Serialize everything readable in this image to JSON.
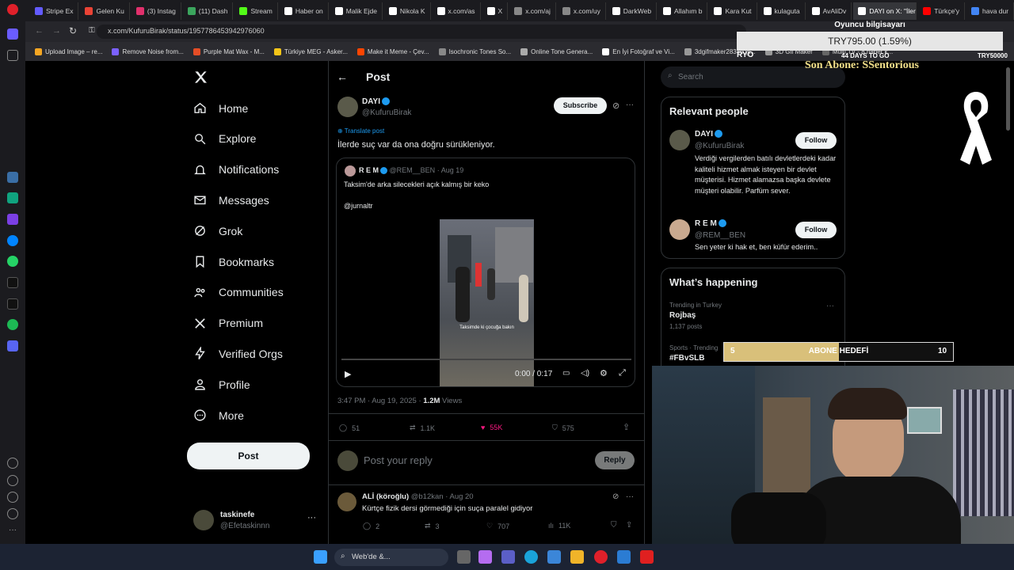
{
  "browser": {
    "tabs": [
      {
        "label": "Stripe Ex",
        "color": "#635bff"
      },
      {
        "label": "Gelen Ku",
        "color": "#ea4335"
      },
      {
        "label": "(3) Instag",
        "color": "#e1306c"
      },
      {
        "label": "(11) Dash",
        "color": "#3ba55d"
      },
      {
        "label": "Stream",
        "color": "#53fc18"
      },
      {
        "label": "Haber on",
        "color": "#ffffff"
      },
      {
        "label": "Malik Ejde",
        "color": "#ffffff"
      },
      {
        "label": "Nikola K",
        "color": "#ffffff"
      },
      {
        "label": "x.com/as",
        "color": "#ffffff"
      },
      {
        "label": "X",
        "color": "#ffffff"
      },
      {
        "label": "x.com/aj",
        "color": "#888888"
      },
      {
        "label": "x.com/uy",
        "color": "#888888"
      },
      {
        "label": "DarkWeb",
        "color": "#ffffff"
      },
      {
        "label": "Allahım b",
        "color": "#ffffff"
      },
      {
        "label": "Kara Kut",
        "color": "#ffffff"
      },
      {
        "label": "kulaguta",
        "color": "#ffffff"
      },
      {
        "label": "AvAliDv",
        "color": "#ffffff"
      },
      {
        "label": "DAYI on X: \"İlerd",
        "color": "#ffffff",
        "active": true
      },
      {
        "label": "Türkçe'y",
        "color": "#ff0000"
      },
      {
        "label": "hava dur",
        "color": "#4285f4"
      }
    ],
    "url": "x.com/KufuruBirak/status/1957786453942976060",
    "bookmarks": [
      {
        "label": "Upload Image – re...",
        "color": "#f5a623"
      },
      {
        "label": "Remove Noise from...",
        "color": "#7b61ff"
      },
      {
        "label": "Purple Mat Wax - M...",
        "color": "#e44d26"
      },
      {
        "label": "Türkiye MEG - Asker...",
        "color": "#f5c518"
      },
      {
        "label": "Make it Meme - Çev...",
        "color": "#ff4500"
      },
      {
        "label": "Isochronic Tones So...",
        "color": "#888888"
      },
      {
        "label": "Online Tone Genera...",
        "color": "#aaaaaa"
      },
      {
        "label": "En İyi Fotoğraf ve Vi...",
        "color": "#ffffff"
      },
      {
        "label": "3dgifmaker28349.gi...",
        "color": "#999999"
      },
      {
        "label": "3D Gif Maker",
        "color": "#999999"
      },
      {
        "label": "Multi TV - 8 haber k...",
        "color": "#666666"
      }
    ]
  },
  "sidebar": {
    "items": [
      {
        "label": "Home",
        "icon": "home-icon"
      },
      {
        "label": "Explore",
        "icon": "search-icon"
      },
      {
        "label": "Notifications",
        "icon": "bell-icon"
      },
      {
        "label": "Messages",
        "icon": "mail-icon"
      },
      {
        "label": "Grok",
        "icon": "grok-icon"
      },
      {
        "label": "Bookmarks",
        "icon": "bookmark-icon"
      },
      {
        "label": "Communities",
        "icon": "people-icon"
      },
      {
        "label": "Premium",
        "icon": "x-icon"
      },
      {
        "label": "Verified Orgs",
        "icon": "lightning-icon"
      },
      {
        "label": "Profile",
        "icon": "person-icon"
      },
      {
        "label": "More",
        "icon": "more-circle-icon"
      }
    ],
    "post_button": "Post",
    "account": {
      "name": "taskinefe",
      "handle": "@Efetaskinnn"
    }
  },
  "post_page": {
    "header_title": "Post",
    "author_name": "DAYI",
    "author_handle": "@KufuruBirak",
    "subscribe_label": "Subscribe",
    "translate_label": "Translate post",
    "text": "İlerde suç var da ona doğru sürükleniyor.",
    "quote": {
      "name": "R E M",
      "handle": "@REM__BEN",
      "date": "Aug 19",
      "text1": "Taksim'de arka silecekleri açık kalmış bir keko",
      "text2": "@jurnaltr",
      "video_caption": "Taksimde ki çocuğa bakın",
      "video_time": "0:00 / 0:17"
    },
    "timestamp": "3:47 PM · Aug 19, 2025 · ",
    "views": "1.2M",
    "views_label": " Views",
    "replies": "51",
    "reposts": "1.1K",
    "likes": "55K",
    "bookmarks": "575",
    "reply_placeholder": "Post your reply",
    "reply_button": "Reply",
    "reply": {
      "name": "ALİ (köroğlu)",
      "handle": "@b12kan · Aug 20",
      "text": "Kürtçe fizik dersi görmediği için suça paralel gidiyor",
      "replies": "2",
      "reposts": "3",
      "likes": "707",
      "views": "11K"
    }
  },
  "right": {
    "search_placeholder": "Search",
    "relevant_title": "Relevant people",
    "people": [
      {
        "name": "DAYI",
        "handle": "@KufuruBirak",
        "bio": "Verdiği vergilerden batılı devletlerdeki kadar kaliteli hizmet almak isteyen bir devlet müşterisi. Hizmet alamazsa başka devlete müşteri olabilir. Parfüm sever.",
        "follow": "Follow"
      },
      {
        "name": "R E M",
        "handle": "@REM__BEN",
        "bio": "Sen yeter ki hak et, ben küfür ederim..",
        "follow": "Follow"
      }
    ],
    "happening_title": "What’s happening",
    "trends": [
      {
        "context": "Trending in Turkey",
        "name": "Rojbaş",
        "count": "1,137 posts"
      },
      {
        "context": "Sports · Trending",
        "name": "#FBvSLB",
        "count": ""
      }
    ]
  },
  "overlay": {
    "pc_label": "Oyuncu bilgisayarı",
    "donation": "TRY795.00 (1.59%)",
    "ryo": "RYO",
    "days": "44 DAYS TO GO",
    "goal": "TRY50000",
    "son_abone": "Son Abone: SSentorious",
    "sub_goal_left": "5",
    "sub_goal_label": "ABONE HEDEFİ",
    "sub_goal_right": "10",
    "sub_goal_progress": 0.5
  },
  "taskbar": {
    "search": "Web'de &..."
  }
}
